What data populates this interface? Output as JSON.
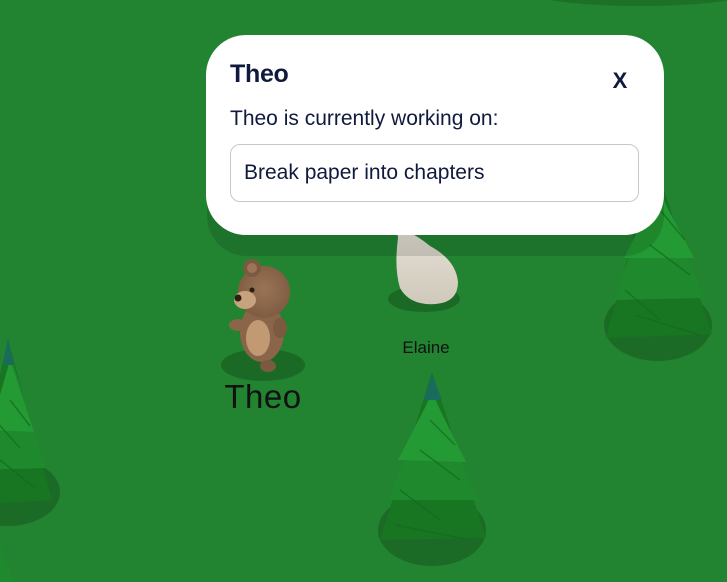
{
  "scene": {
    "ground_color": "#228331",
    "tree_color": "#1d7a2a",
    "characters": [
      {
        "name": "Theo",
        "avatar": "bear-avatar"
      },
      {
        "name": "Elaine",
        "avatar": "ghost-avatar"
      }
    ]
  },
  "popup": {
    "title": "Theo",
    "close_label": "X",
    "label": "Theo is currently working on:",
    "task": "Break paper into chapters"
  }
}
